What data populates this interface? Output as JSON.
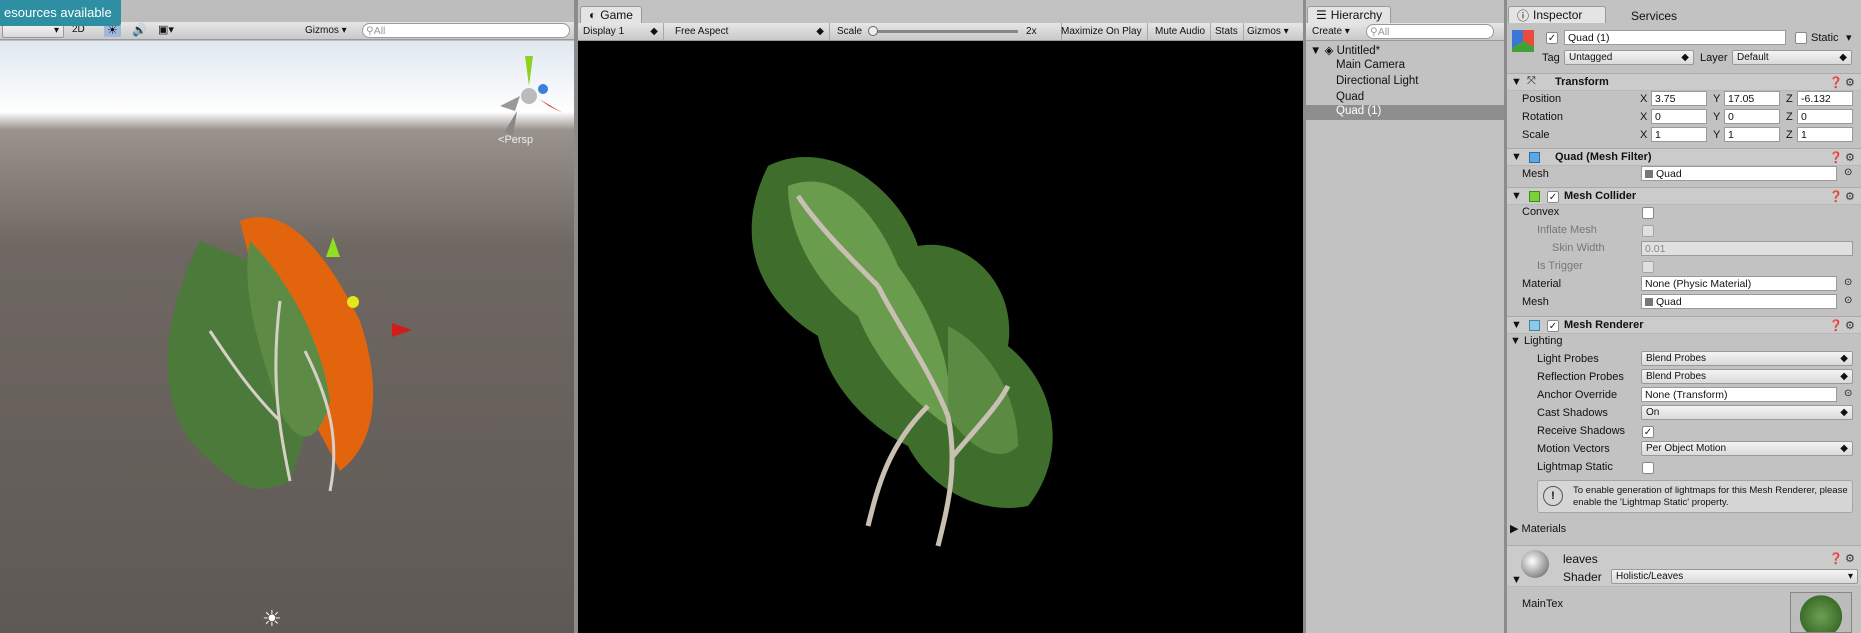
{
  "scene": {
    "banner": "esources available",
    "btn_2d": "2D",
    "gizmos": "Gizmos",
    "search_ph": "All",
    "persp": "Persp"
  },
  "game": {
    "tab": "Game",
    "display": "Display 1",
    "aspect": "Free Aspect",
    "scale_label": "Scale",
    "scale_value": "2x",
    "maximize": "Maximize On Play",
    "mute": "Mute Audio",
    "stats": "Stats",
    "gizmos": "Gizmos"
  },
  "hierarchy": {
    "tab": "Hierarchy",
    "create": "Create",
    "search_ph": "All",
    "scene": "Untitled*",
    "items": [
      "Main Camera",
      "Directional Light",
      "Quad",
      "Quad (1)"
    ]
  },
  "inspector": {
    "tab": "Inspector",
    "services": "Services",
    "name": "Quad (1)",
    "static": "Static",
    "tag_label": "Tag",
    "tag": "Untagged",
    "layer_label": "Layer",
    "layer": "Default",
    "transform": {
      "title": "Transform",
      "position": "Position",
      "rotation": "Rotation",
      "scale": "Scale",
      "x": "X",
      "y": "Y",
      "z": "Z",
      "pos": [
        "3.75",
        "17.05",
        "-6.132"
      ],
      "rot": [
        "0",
        "0",
        "0"
      ],
      "scl": [
        "1",
        "1",
        "1"
      ]
    },
    "mesh_filter": {
      "title": "Quad (Mesh Filter)",
      "mesh_label": "Mesh",
      "mesh": "Quad"
    },
    "collider": {
      "title": "Mesh Collider",
      "convex": "Convex",
      "inflate": "Inflate Mesh",
      "skin": "Skin Width",
      "skin_val": "0.01",
      "trigger": "Is Trigger",
      "material_label": "Material",
      "material": "None (Physic Material)",
      "mesh_label": "Mesh",
      "mesh": "Quad"
    },
    "renderer": {
      "title": "Mesh Renderer",
      "lighting": "Lighting",
      "light_probes": "Light Probes",
      "light_probes_val": "Blend Probes",
      "refl_probes": "Reflection Probes",
      "refl_probes_val": "Blend Probes",
      "anchor": "Anchor Override",
      "anchor_val": "None (Transform)",
      "cast": "Cast Shadows",
      "cast_val": "On",
      "receive": "Receive Shadows",
      "motion": "Motion Vectors",
      "motion_val": "Per Object Motion",
      "lightmap": "Lightmap Static",
      "info": "To enable generation of lightmaps for this Mesh Renderer, please enable the 'Lightmap Static' property.",
      "materials": "Materials"
    },
    "material": {
      "name": "leaves",
      "shader_label": "Shader",
      "shader": "Holistic/Leaves",
      "maintex": "MainTex"
    }
  }
}
